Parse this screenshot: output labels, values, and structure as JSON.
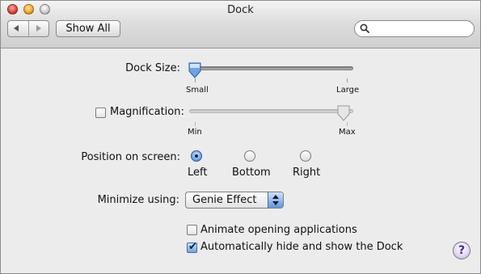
{
  "window": {
    "title": "Dock"
  },
  "toolbar": {
    "back_icon": "arrow-left-icon",
    "forward_icon": "arrow-right-icon",
    "show_all_label": "Show All",
    "search": {
      "value": "",
      "placeholder": ""
    }
  },
  "dock_size": {
    "label": "Dock Size:",
    "min_label": "Small",
    "max_label": "Large",
    "value_fraction": 0.0
  },
  "magnification": {
    "label": "Magnification:",
    "checked": false,
    "min_label": "Min",
    "max_label": "Max",
    "value_fraction": 0.98
  },
  "position": {
    "label": "Position on screen:",
    "options": [
      {
        "label": "Left",
        "selected": true
      },
      {
        "label": "Bottom",
        "selected": false
      },
      {
        "label": "Right",
        "selected": false
      }
    ]
  },
  "minimize": {
    "label": "Minimize using:",
    "selected": "Genie Effect"
  },
  "checkboxes": {
    "animate": {
      "label": "Animate opening applications",
      "checked": false
    },
    "autohide": {
      "label": "Automatically hide and show the Dock",
      "checked": true
    }
  },
  "help": {
    "label": "?"
  },
  "colors": {
    "accent": "#5c97e0",
    "window_bg": "#ececec"
  }
}
